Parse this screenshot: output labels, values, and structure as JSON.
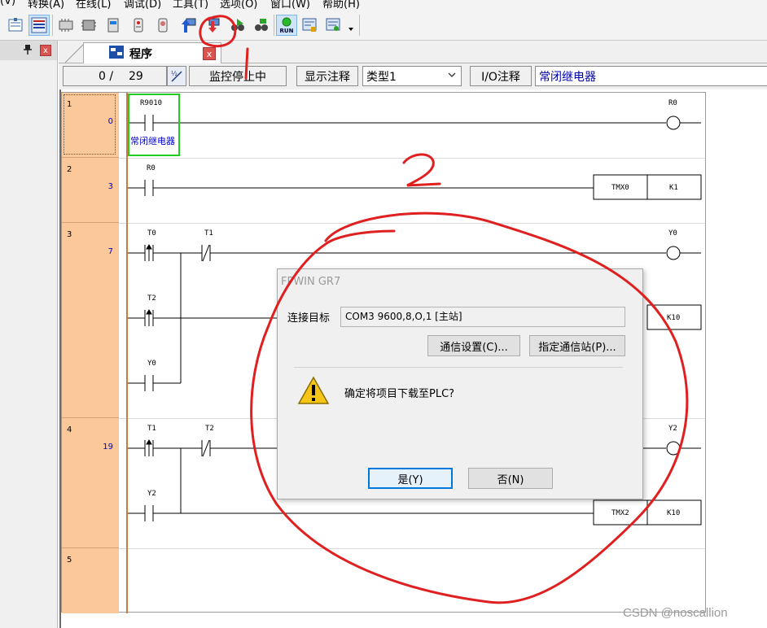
{
  "menu": {
    "items": [
      "(V)",
      "转换(A)",
      "在线(L)",
      "调试(D)",
      "工具(T)",
      "选项(O)",
      "窗口(W)",
      "帮助(H)"
    ]
  },
  "toolbar": {
    "buttons": [
      "ladder-list-icon",
      "instruction-list-icon",
      "plc-icon",
      "plc-chip-icon",
      "plc-device-icon",
      "plc-module-icon",
      "upload-from-plc-icon",
      "download-to-plc-icon",
      "monitor-icon",
      "monitor-start-icon",
      "run-icon",
      "remote-stop-icon",
      "print-icon",
      "more-dropdown-icon"
    ],
    "run_label": "RUN"
  },
  "left_pane": {
    "pin": "📌",
    "close": "x"
  },
  "tab": {
    "label": "程序",
    "close": "x"
  },
  "infobar": {
    "step": "0 /",
    "total": "29",
    "monitor_status": "监控停止中",
    "show_comment": "显示注释",
    "type_value": "类型1",
    "io_comment": "I/O注释",
    "comment_value": "常闭继电器"
  },
  "ladder": {
    "rungs": [
      {
        "no": "1",
        "step": "0"
      },
      {
        "no": "2",
        "step": "3"
      },
      {
        "no": "3",
        "step": "7"
      },
      {
        "no": "4",
        "step": "19"
      },
      {
        "no": "5",
        "step": ""
      }
    ],
    "contacts": {
      "r9010": "R9010",
      "r9010_comment": "常闭继电器",
      "r0_out": "R0",
      "r0_in": "R0",
      "tmx0": "TMX0",
      "k1": "K1",
      "t0": "T0",
      "t1": "T1",
      "y0_out": "Y0",
      "t2": "T2",
      "k10_a": "K10",
      "y0_in": "Y0",
      "t1_b": "T1",
      "t2_b": "T2",
      "y2_out": "Y2",
      "y2_in": "Y2",
      "tmx2": "TMX2",
      "k10_b": "K10"
    }
  },
  "dialog": {
    "title": "FPWIN GR7",
    "target_label": "连接目标",
    "target_value": "COM3 9600,8,O,1 [主站]",
    "comm_settings": "通信设置(C)...",
    "specify_station": "指定通信站(P)...",
    "message": "确定将项目下载至PLC?",
    "yes": "是(Y)",
    "no": "否(N)"
  },
  "annotations": {
    "one": "1",
    "two": "2"
  },
  "watermark": "CSDN @noscallion",
  "colors": {
    "rung_number_bg": "#fbc89a",
    "accent": "#0078d7",
    "annotation_red": "#e02020",
    "selection_green": "#22cc22"
  }
}
